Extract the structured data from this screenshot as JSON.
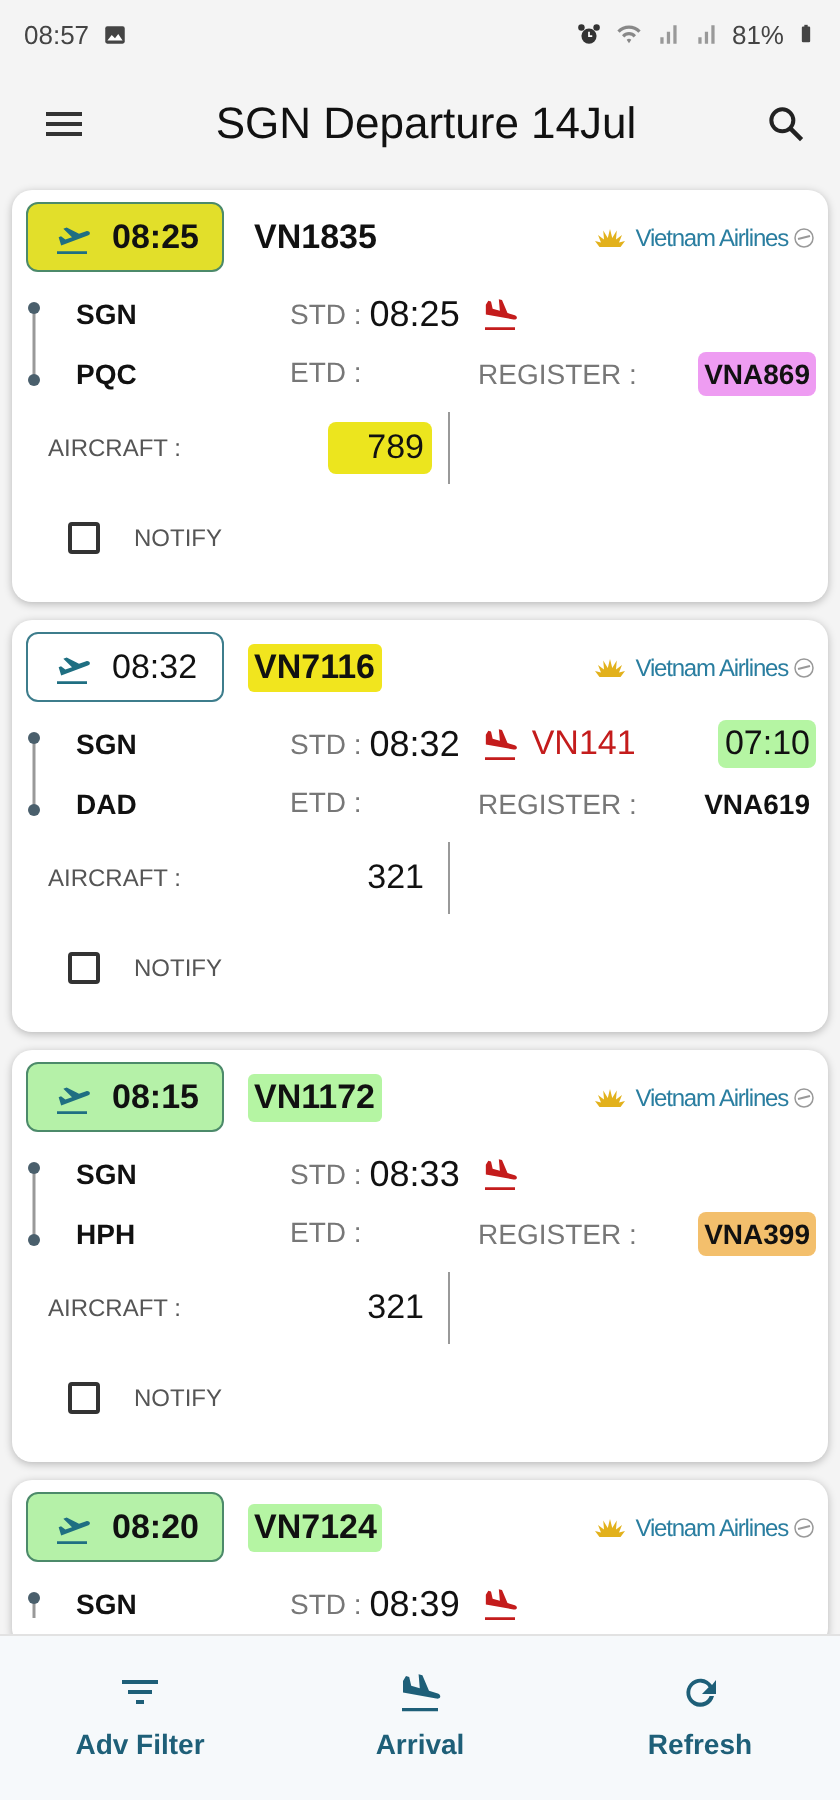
{
  "status_bar": {
    "time": "08:57",
    "battery": "81%"
  },
  "app_bar": {
    "title": "SGN Departure 14Jul"
  },
  "flights": [
    {
      "time": {
        "text": "08:25",
        "color": "#e2df2a"
      },
      "flight": {
        "text": "VN1835"
      },
      "airline": "Vietnam Airlines",
      "origin": "SGN",
      "destination": "PQC",
      "std_label": "STD :",
      "std": "08:25",
      "etd_label": "ETD :",
      "register_label": "REGISTER :",
      "register": {
        "text": "VNA869",
        "color": "#ee9cf2"
      },
      "aircraft_label": "AIRCRAFT :",
      "aircraft": {
        "text": "789",
        "color": "#ece51e"
      },
      "notify": {
        "label": "NOTIFY",
        "checked": false
      }
    },
    {
      "time": {
        "text": "08:32"
      },
      "flight": {
        "text": "VN7116",
        "color": "#f1e51e"
      },
      "airline": "Vietnam Airlines",
      "origin": "SGN",
      "destination": "DAD",
      "std_label": "STD :",
      "std": "08:32",
      "arrival_flight": "VN141",
      "arrival_time": {
        "text": "07:10",
        "color": "#b5f5a3"
      },
      "etd_label": "ETD :",
      "register_label": "REGISTER :",
      "register": {
        "text": "VNA619"
      },
      "aircraft_label": "AIRCRAFT :",
      "aircraft": {
        "text": "321"
      },
      "notify": {
        "label": "NOTIFY",
        "checked": false
      }
    },
    {
      "time": {
        "text": "08:15",
        "color": "#b5f1a8"
      },
      "flight": {
        "text": "VN1172",
        "color": "#b5f5a3"
      },
      "airline": "Vietnam Airlines",
      "origin": "SGN",
      "destination": "HPH",
      "std_label": "STD :",
      "std": "08:33",
      "etd_label": "ETD :",
      "register_label": "REGISTER :",
      "register": {
        "text": "VNA399",
        "color": "#f3bf6c"
      },
      "aircraft_label": "AIRCRAFT :",
      "aircraft": {
        "text": "321"
      },
      "notify": {
        "label": "NOTIFY",
        "checked": false
      }
    },
    {
      "time": {
        "text": "08:20",
        "color": "#b5f1a8"
      },
      "flight": {
        "text": "VN7124",
        "color": "#b5f5a3"
      },
      "airline": "Vietnam Airlines",
      "origin": "SGN",
      "std_label": "STD :",
      "std": "08:39"
    }
  ],
  "bottom_nav": [
    {
      "kind": "filter",
      "label": "Adv Filter"
    },
    {
      "kind": "arrival",
      "label": "Arrival"
    },
    {
      "kind": "refresh",
      "label": "Refresh"
    }
  ]
}
